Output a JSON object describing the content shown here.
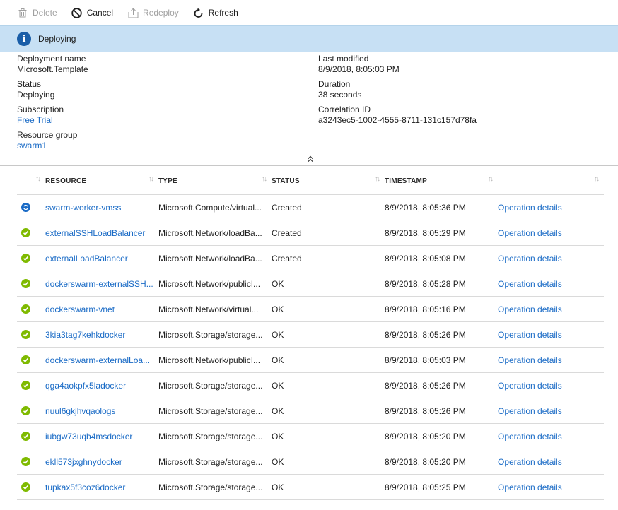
{
  "toolbar": {
    "delete_label": "Delete",
    "cancel_label": "Cancel",
    "redeploy_label": "Redeploy",
    "refresh_label": "Refresh"
  },
  "banner": {
    "text": "Deploying"
  },
  "essentials": {
    "deployment_name_label": "Deployment name",
    "deployment_name": "Microsoft.Template",
    "status_label": "Status",
    "status": "Deploying",
    "subscription_label": "Subscription",
    "subscription": "Free Trial",
    "resource_group_label": "Resource group",
    "resource_group": "swarm1",
    "last_modified_label": "Last modified",
    "last_modified": "8/9/2018, 8:05:03 PM",
    "duration_label": "Duration",
    "duration": "38 seconds",
    "correlation_label": "Correlation ID",
    "correlation_id": "a3243ec5-1002-4555-8711-131c157d78fa"
  },
  "table": {
    "headers": [
      "RESOURCE",
      "TYPE",
      "STATUS",
      "TIMESTAMP"
    ],
    "rows": [
      {
        "icon": "in-progress",
        "resource": "swarm-worker-vmss",
        "type": "Microsoft.Compute/virtual...",
        "status": "Created",
        "timestamp": "8/9/2018, 8:05:36 PM",
        "action": "Operation details"
      },
      {
        "icon": "success",
        "resource": "externalSSHLoadBalancer",
        "type": "Microsoft.Network/loadBa...",
        "status": "Created",
        "timestamp": "8/9/2018, 8:05:29 PM",
        "action": "Operation details"
      },
      {
        "icon": "success",
        "resource": "externalLoadBalancer",
        "type": "Microsoft.Network/loadBa...",
        "status": "Created",
        "timestamp": "8/9/2018, 8:05:08 PM",
        "action": "Operation details"
      },
      {
        "icon": "success",
        "resource": "dockerswarm-externalSSH...",
        "type": "Microsoft.Network/publicI...",
        "status": "OK",
        "timestamp": "8/9/2018, 8:05:28 PM",
        "action": "Operation details"
      },
      {
        "icon": "success",
        "resource": "dockerswarm-vnet",
        "type": "Microsoft.Network/virtual...",
        "status": "OK",
        "timestamp": "8/9/2018, 8:05:16 PM",
        "action": "Operation details"
      },
      {
        "icon": "success",
        "resource": "3kia3tag7kehkdocker",
        "type": "Microsoft.Storage/storage...",
        "status": "OK",
        "timestamp": "8/9/2018, 8:05:26 PM",
        "action": "Operation details"
      },
      {
        "icon": "success",
        "resource": "dockerswarm-externalLoa...",
        "type": "Microsoft.Network/publicI...",
        "status": "OK",
        "timestamp": "8/9/2018, 8:05:03 PM",
        "action": "Operation details"
      },
      {
        "icon": "success",
        "resource": "qga4aokpfx5ladocker",
        "type": "Microsoft.Storage/storage...",
        "status": "OK",
        "timestamp": "8/9/2018, 8:05:26 PM",
        "action": "Operation details"
      },
      {
        "icon": "success",
        "resource": "nuul6gkjhvqaologs",
        "type": "Microsoft.Storage/storage...",
        "status": "OK",
        "timestamp": "8/9/2018, 8:05:26 PM",
        "action": "Operation details"
      },
      {
        "icon": "success",
        "resource": "iubgw73uqb4msdocker",
        "type": "Microsoft.Storage/storage...",
        "status": "OK",
        "timestamp": "8/9/2018, 8:05:20 PM",
        "action": "Operation details"
      },
      {
        "icon": "success",
        "resource": "ekll573jxghnydocker",
        "type": "Microsoft.Storage/storage...",
        "status": "OK",
        "timestamp": "8/9/2018, 8:05:20 PM",
        "action": "Operation details"
      },
      {
        "icon": "success",
        "resource": "tupkax5f3coz6docker",
        "type": "Microsoft.Storage/storage...",
        "status": "OK",
        "timestamp": "8/9/2018, 8:05:25 PM",
        "action": "Operation details"
      }
    ]
  }
}
